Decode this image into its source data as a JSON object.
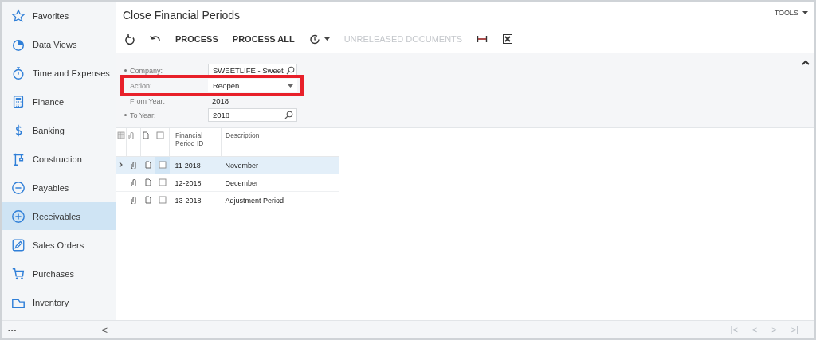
{
  "sidebar": {
    "items": [
      {
        "label": "Favorites",
        "selected": false
      },
      {
        "label": "Data Views",
        "selected": false
      },
      {
        "label": "Time and Expenses",
        "selected": false
      },
      {
        "label": "Finance",
        "selected": false
      },
      {
        "label": "Banking",
        "selected": false
      },
      {
        "label": "Construction",
        "selected": false
      },
      {
        "label": "Payables",
        "selected": false
      },
      {
        "label": "Receivables",
        "selected": true
      },
      {
        "label": "Sales Orders",
        "selected": false
      },
      {
        "label": "Purchases",
        "selected": false
      },
      {
        "label": "Inventory",
        "selected": false
      }
    ],
    "footer": {
      "more": "•••",
      "collapse": "<"
    }
  },
  "page": {
    "title": "Close Financial Periods",
    "tools": "TOOLS"
  },
  "toolbar": [
    {
      "kind": "refresh"
    },
    {
      "kind": "undo"
    },
    {
      "kind": "text",
      "label": "PROCESS",
      "disabled": false
    },
    {
      "kind": "text",
      "label": "PROCESS ALL",
      "disabled": false
    },
    {
      "kind": "schedule"
    },
    {
      "kind": "text",
      "label": "UNRELEASED DOCUMENTS",
      "disabled": true
    },
    {
      "kind": "fit"
    },
    {
      "kind": "excel"
    }
  ],
  "form": {
    "fields": [
      {
        "label": "Company:",
        "required": true,
        "kind": "lookup",
        "value": "SWEETLIFE - Sweet",
        "highlighted": false
      },
      {
        "label": "Action:",
        "required": false,
        "kind": "select",
        "value": "Reopen",
        "highlighted": true
      },
      {
        "label": "From Year:",
        "required": false,
        "kind": "readonly",
        "value": "2018",
        "highlighted": false
      },
      {
        "label": "To Year:",
        "required": true,
        "kind": "lookup",
        "value": "2018",
        "highlighted": false
      }
    ]
  },
  "table": {
    "columns": [
      "Financial Period ID",
      "Description"
    ],
    "all_checked": false,
    "rows": [
      {
        "period": "11-2018",
        "description": "November",
        "selected": true,
        "checked": false
      },
      {
        "period": "12-2018",
        "description": "December",
        "selected": false,
        "checked": false
      },
      {
        "period": "13-2018",
        "description": "Adjustment Period",
        "selected": false,
        "checked": false
      }
    ]
  },
  "pager": [
    "|<",
    "<",
    ">",
    ">|"
  ]
}
